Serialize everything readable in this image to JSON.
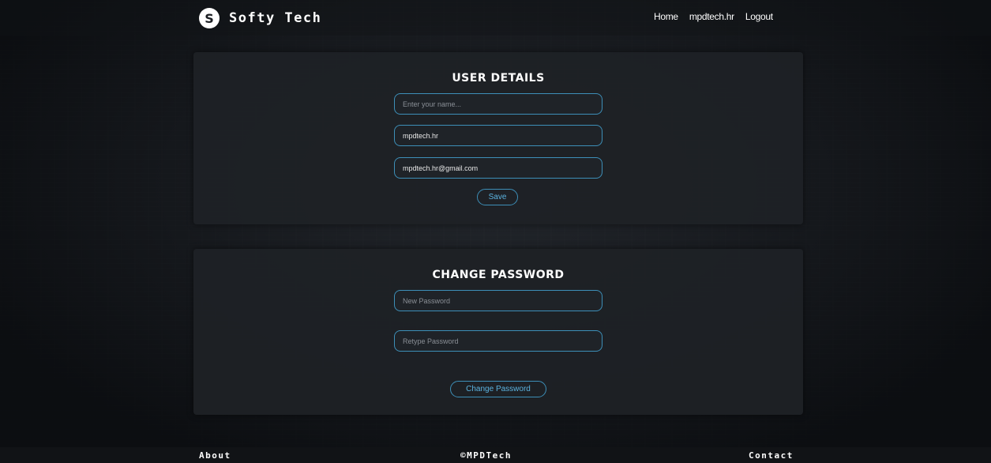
{
  "brand": {
    "logo_glyph": "S",
    "name": "Softy Tech"
  },
  "nav": {
    "home": "Home",
    "user": "mpdtech.hr",
    "logout": "Logout"
  },
  "user_details": {
    "title": "USER DETAILS",
    "name_placeholder": "Enter your name...",
    "username_value": "mpdtech.hr",
    "email_value": "mpdtech.hr@gmail.com",
    "save_label": "Save"
  },
  "change_password": {
    "title": "CHANGE PASSWORD",
    "new_password_placeholder": "New Password",
    "retype_password_placeholder": "Retype Password",
    "submit_label": "Change Password"
  },
  "footer": {
    "about": "About",
    "copyright": "©MPDTech",
    "contact": "Contact"
  },
  "colors": {
    "accent": "#3d8fb8",
    "accent_text": "#5bb3e0",
    "panel": "#1e2126",
    "background": "#14171b"
  }
}
